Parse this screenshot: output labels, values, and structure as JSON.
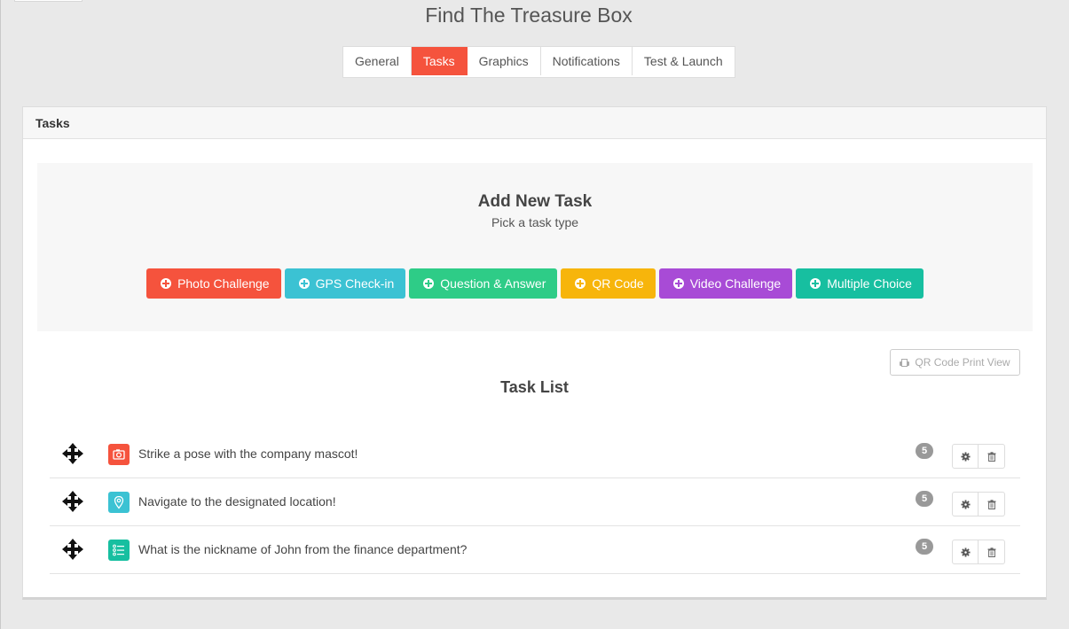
{
  "page": {
    "title": "Find The Treasure Box"
  },
  "tabs": [
    {
      "label": "General",
      "active": false
    },
    {
      "label": "Tasks",
      "active": true
    },
    {
      "label": "Graphics",
      "active": false
    },
    {
      "label": "Notifications",
      "active": false
    },
    {
      "label": "Test & Launch",
      "active": false
    }
  ],
  "panel": {
    "header": "Tasks"
  },
  "add_task": {
    "title": "Add New Task",
    "subtitle": "Pick a task type",
    "types": [
      {
        "label": "Photo Challenge",
        "color": "#f5533d",
        "icon": "plus-circle-icon"
      },
      {
        "label": "GPS Check-in",
        "color": "#3bc2d3",
        "icon": "plus-circle-icon"
      },
      {
        "label": "Question & Answer",
        "color": "#2ecc87",
        "icon": "plus-circle-icon"
      },
      {
        "label": "QR Code",
        "color": "#f7b50b",
        "icon": "plus-circle-icon"
      },
      {
        "label": "Video Challenge",
        "color": "#a84bd6",
        "icon": "plus-circle-icon"
      },
      {
        "label": "Multiple Choice",
        "color": "#17bfa0",
        "icon": "plus-circle-icon"
      }
    ]
  },
  "print_button": {
    "label": "QR Code Print View",
    "icon": "printer-icon"
  },
  "task_list": {
    "title": "Task List",
    "items": [
      {
        "text": "Strike a pose with the company mascot!",
        "points": "5",
        "type_icon": "camera-icon",
        "type_color": "#f5533d"
      },
      {
        "text": "Navigate to the designated location!",
        "points": "5",
        "type_icon": "map-pin-icon",
        "type_color": "#3bc2d3"
      },
      {
        "text": "What is the nickname of John from the finance department?",
        "points": "5",
        "type_icon": "list-icon",
        "type_color": "#17bfa0"
      }
    ]
  }
}
